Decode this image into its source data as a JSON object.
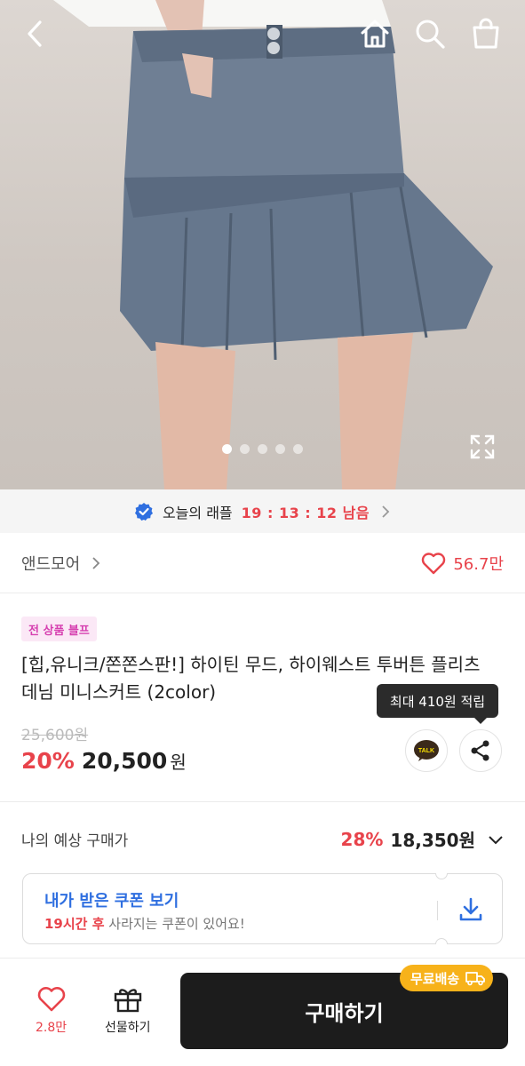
{
  "header": {
    "back_icon": "chevron-left-icon",
    "home_icon": "home-icon",
    "search_icon": "search-icon",
    "cart_icon": "shopping-bag-icon"
  },
  "gallery": {
    "image": "denim-pleated-mini-skirt-photo",
    "slide_count": 5,
    "active_slide": 1
  },
  "raffle": {
    "label": "오늘의 래플",
    "time": "19 : 13 : 12 남음",
    "accent": "#e8434b"
  },
  "brand": {
    "name": "앤드모어",
    "likes": "56.7만"
  },
  "product": {
    "badge": "전 상품 블프",
    "title": "[힙,유니크/쫀쫀스판!] 하이틴 무드, 하이웨스트 투버튼 플리츠 데님 미니스커트 (2color)",
    "original_price": "25,600원",
    "discount": "20%",
    "price": "20,500",
    "currency": "원",
    "points_tooltip": "최대 410원 적립",
    "talk_label": "TALK"
  },
  "expected": {
    "label": "나의 예상 구매가",
    "discount": "28%",
    "price": "18,350원"
  },
  "coupon": {
    "title": "내가 받은 쿠폰 보기",
    "highlight": "19시간 후",
    "subtitle": " 사라지는 쿠폰이 있어요!"
  },
  "bottom_bar": {
    "like_count": "2.8만",
    "gift_label": "선물하기",
    "buy_label": "구매하기",
    "free_shipping": "무료배송"
  },
  "colors": {
    "accent_red": "#e8434b",
    "coupon_blue": "#2f6fe0",
    "badge_pink": "#d63fb0",
    "shipping_yellow": "#f7b21a"
  }
}
